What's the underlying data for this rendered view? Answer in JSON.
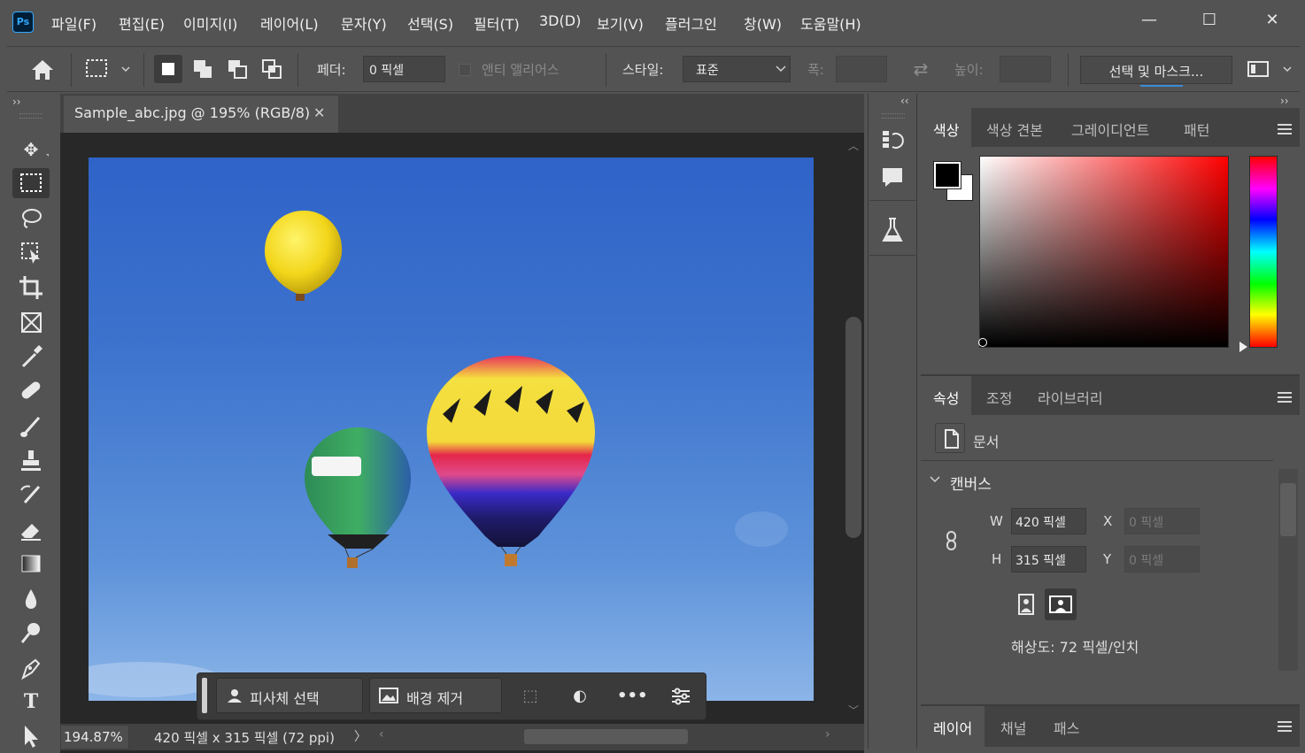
{
  "app": {
    "logo": "Ps"
  },
  "menu": [
    "파일(F)",
    "편집(E)",
    "이미지(I)",
    "레이어(L)",
    "문자(Y)",
    "선택(S)",
    "필터(T)",
    "3D(D)",
    "보기(V)",
    "플러그인",
    "창(W)",
    "도움말(H)"
  ],
  "window_controls": {
    "minimize": "—",
    "maximize": "☐",
    "close": "✕"
  },
  "options": {
    "feather_label": "페더:",
    "feather_value": "0 픽셀",
    "antialias_label": "앤티 앨리어스",
    "style_label": "스타일:",
    "style_value": "표준",
    "width_label": "폭:",
    "height_label": "높이:",
    "select_mask_button": "선택 및 마스크..."
  },
  "document": {
    "tab_title": "Sample_abc.jpg @ 195% (RGB/8)",
    "zoom": "194.87%",
    "info": "420 픽셀 x 315 픽셀 (72 ppi)"
  },
  "context_bar": {
    "select_subject": "피사체 선택",
    "remove_bg": "배경 제거"
  },
  "color_panel": {
    "tabs": [
      "색상",
      "색상 견본",
      "그레이디언트",
      "패턴"
    ],
    "foreground": "#000000",
    "background": "#ffffff"
  },
  "properties_panel": {
    "tabs": [
      "속성",
      "조정",
      "라이브러리"
    ],
    "doc_label": "문서",
    "canvas_header": "캔버스",
    "w_label": "W",
    "w_value": "420 픽셀",
    "h_label": "H",
    "h_value": "315 픽셀",
    "x_label": "X",
    "x_value": "0 픽셀",
    "y_label": "Y",
    "y_value": "0 픽셀",
    "resolution": "해상도: 72 픽셀/인치"
  },
  "layers_panel": {
    "tabs": [
      "레이어",
      "채널",
      "패스"
    ]
  }
}
